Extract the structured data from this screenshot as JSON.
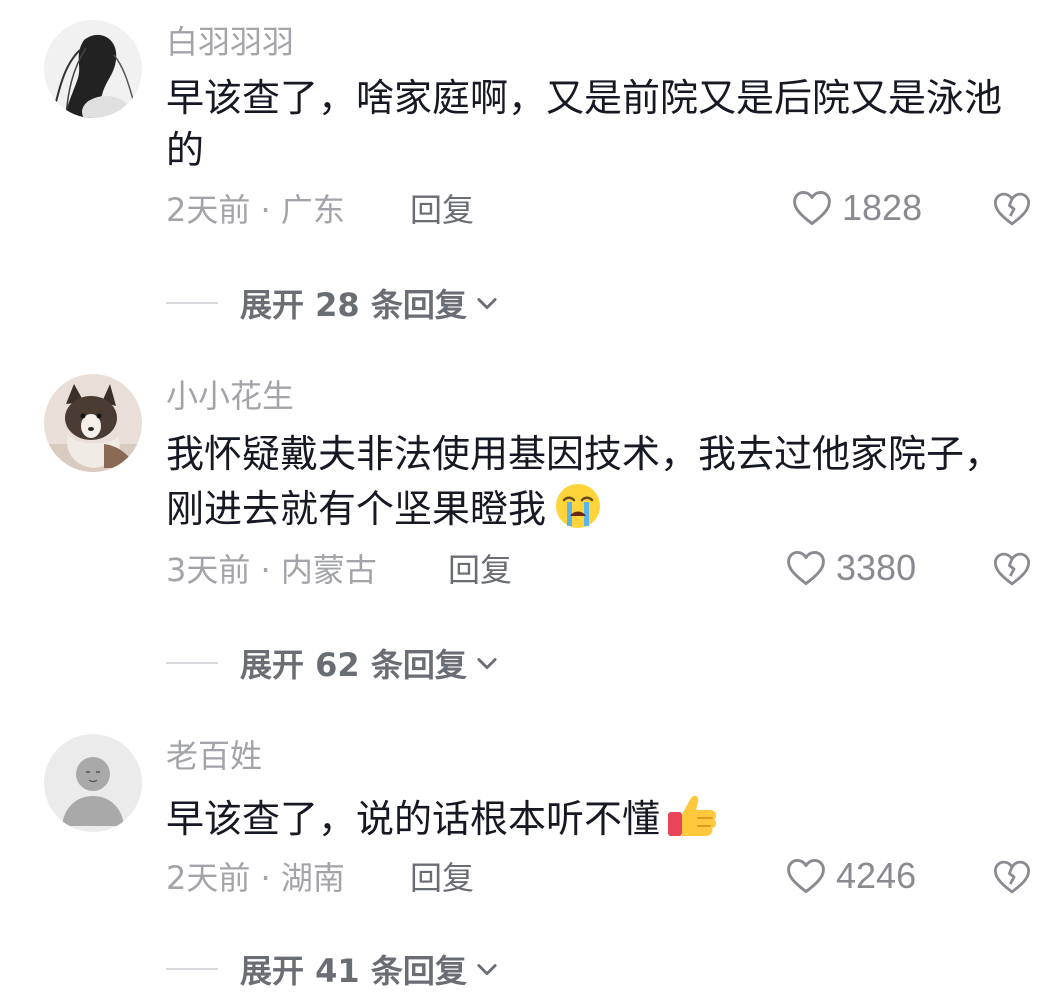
{
  "comments": [
    {
      "username": "白羽羽羽",
      "text": "早该查了，啥家庭啊，又是前院又是后院又是泳池的",
      "emoji": "",
      "time": "2天前",
      "location": "广东",
      "meta": "2天前 · 广东",
      "reply_label": "回复",
      "likes": "1828",
      "expand_label": "展开 28 条回复"
    },
    {
      "username": "小小花生",
      "text": "我怀疑戴夫非法使用基因技术，我去过他家院子，刚进去就有个坚果瞪我",
      "emoji": "crying-face",
      "time": "3天前",
      "location": "内蒙古",
      "meta": "3天前 · 内蒙古",
      "reply_label": "回复",
      "likes": "3380",
      "expand_label": "展开 62 条回复"
    },
    {
      "username": "老百姓",
      "text": "早该查了，说的话根本听不懂",
      "emoji": "thumbs-up",
      "time": "2天前",
      "location": "湖南",
      "meta": "2天前 · 湖南",
      "reply_label": "回复",
      "likes": "4246",
      "expand_label": "展开 41 条回复"
    }
  ],
  "icons": {
    "like": "heart-outline-icon",
    "dislike": "broken-heart-icon",
    "expand": "chevron-down-icon"
  },
  "colors": {
    "primary_text": "#161823",
    "secondary_text": "#a3a4a9",
    "action_text": "#6b6d74",
    "icon": "#8a8b91"
  }
}
